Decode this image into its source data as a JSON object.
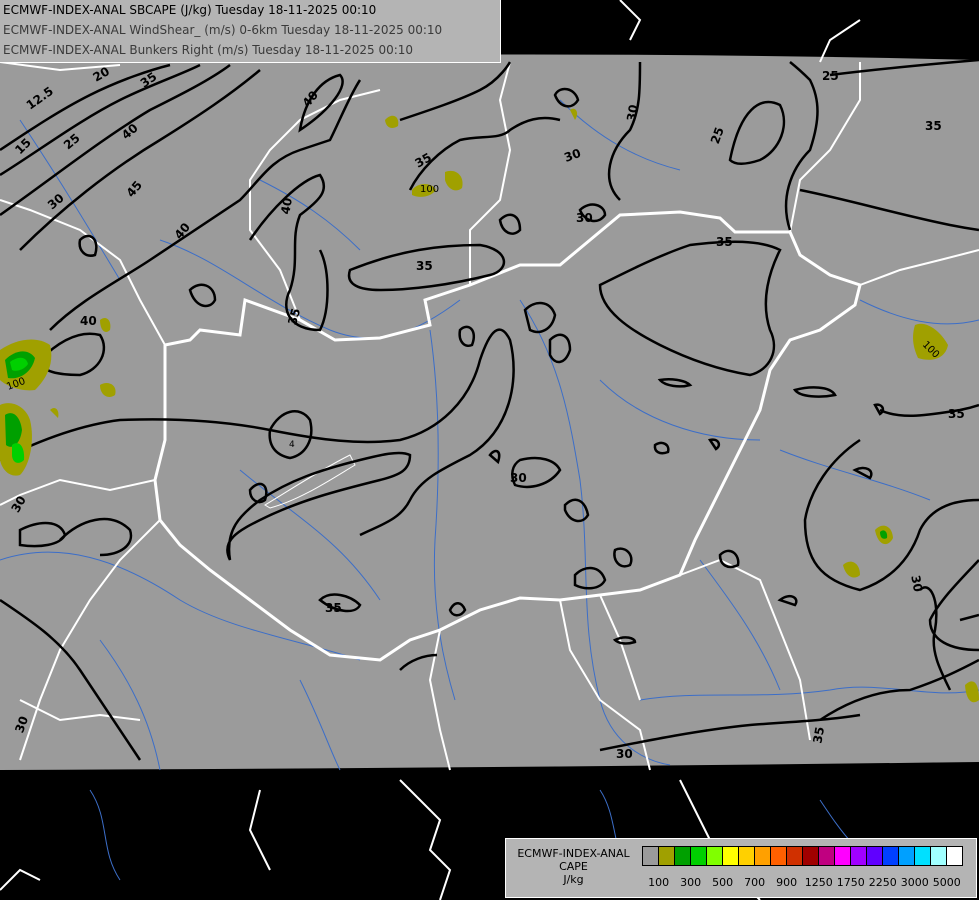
{
  "header": {
    "line1": "ECMWF-INDEX-ANAL SBCAPE (J/kg) Tuesday 18-11-2025 00:10",
    "line2": "ECMWF-INDEX-ANAL WindShear_ (m/s) 0-6km Tuesday 18-11-2025 00:10",
    "line3": "ECMWF-INDEX-ANAL Bunkers Right (m/s) Tuesday 18-11-2025 00:10"
  },
  "legend": {
    "title_line1": "ECMWF-INDEX-ANAL",
    "title_line2": "CAPE",
    "title_line3": "J/kg",
    "swatch_colors": [
      "#9b9b9b",
      "#a0a000",
      "#00a000",
      "#00d000",
      "#80ff00",
      "#ffff00",
      "#ffd000",
      "#ffa000",
      "#ff6000",
      "#d03000",
      "#a00000",
      "#c00080",
      "#ff00ff",
      "#a000ff",
      "#6000ff",
      "#0040ff",
      "#00a0ff",
      "#00e0ff",
      "#a0ffff",
      "#ffffff"
    ],
    "labels": [
      "100",
      "300",
      "500",
      "700",
      "900",
      "1250",
      "1750",
      "2250",
      "3000",
      "5000"
    ]
  },
  "contour_labels": [
    "12.5",
    "20",
    "35",
    "40",
    "15",
    "25",
    "40",
    "45",
    "30",
    "40",
    "40",
    "35",
    "40",
    "35",
    "30",
    "30",
    "25",
    "35",
    "30",
    "35",
    "35",
    "100",
    "100",
    "30",
    "35",
    "30",
    "35",
    "30",
    "35",
    "30",
    "100",
    "4",
    "25"
  ],
  "colors": {
    "land": "#9b9b9b",
    "offdomain": "#000000",
    "borders": "#ffffff",
    "rivers": "#3c6ec8",
    "contours": "#000000"
  }
}
